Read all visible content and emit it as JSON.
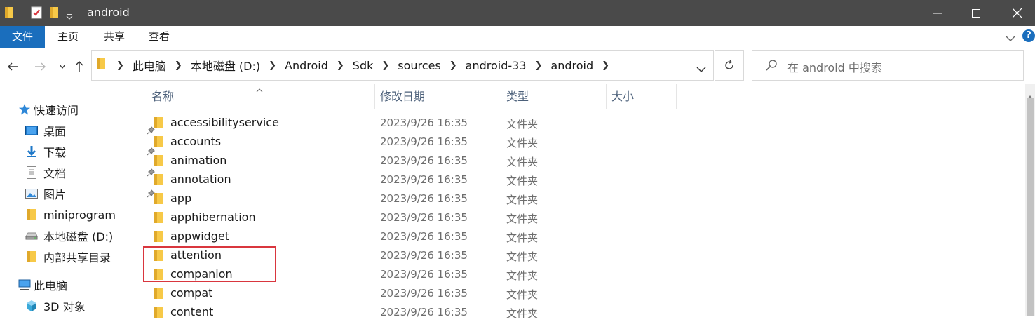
{
  "window": {
    "title": "android"
  },
  "ribbon": {
    "tabs": [
      "文件",
      "主页",
      "共享",
      "查看"
    ],
    "help": "?"
  },
  "address": {
    "crumbs": [
      "此电脑",
      "本地磁盘 (D:)",
      "Android",
      "Sdk",
      "sources",
      "android-33",
      "android"
    ]
  },
  "search": {
    "placeholder": "在 android 中搜索"
  },
  "sidebar": {
    "quick_access": "快速访问",
    "items": [
      {
        "label": "桌面",
        "icon": "desktop-icon",
        "pinned": true
      },
      {
        "label": "下载",
        "icon": "download-icon",
        "pinned": true
      },
      {
        "label": "文档",
        "icon": "document-icon",
        "pinned": true
      },
      {
        "label": "图片",
        "icon": "picture-icon",
        "pinned": true
      },
      {
        "label": "miniprogram",
        "icon": "folder-icon",
        "pinned": false
      },
      {
        "label": "本地磁盘 (D:)",
        "icon": "drive-icon",
        "pinned": false
      },
      {
        "label": "内部共享目录",
        "icon": "folder-icon",
        "pinned": false
      }
    ],
    "this_pc": "此电脑",
    "objects_3d": "3D 对象"
  },
  "columns": {
    "name": "名称",
    "date": "修改日期",
    "type": "类型",
    "size": "大小"
  },
  "files": [
    {
      "name": "accessibilityservice",
      "date": "2023/9/26 16:35",
      "type": "文件夹"
    },
    {
      "name": "accounts",
      "date": "2023/9/26 16:35",
      "type": "文件夹"
    },
    {
      "name": "animation",
      "date": "2023/9/26 16:35",
      "type": "文件夹"
    },
    {
      "name": "annotation",
      "date": "2023/9/26 16:35",
      "type": "文件夹"
    },
    {
      "name": "app",
      "date": "2023/9/26 16:35",
      "type": "文件夹"
    },
    {
      "name": "apphibernation",
      "date": "2023/9/26 16:35",
      "type": "文件夹"
    },
    {
      "name": "appwidget",
      "date": "2023/9/26 16:35",
      "type": "文件夹"
    },
    {
      "name": "attention",
      "date": "2023/9/26 16:35",
      "type": "文件夹"
    },
    {
      "name": "companion",
      "date": "2023/9/26 16:35",
      "type": "文件夹"
    },
    {
      "name": "compat",
      "date": "2023/9/26 16:35",
      "type": "文件夹"
    },
    {
      "name": "content",
      "date": "2023/9/26 16:35",
      "type": "文件夹"
    }
  ],
  "highlight": {
    "color": "#d9363e",
    "rows": [
      "attention",
      "companion"
    ]
  },
  "colors": {
    "accent": "#1a6ebd",
    "titlebar": "#4a4a4a",
    "folder": "#f7c948"
  }
}
